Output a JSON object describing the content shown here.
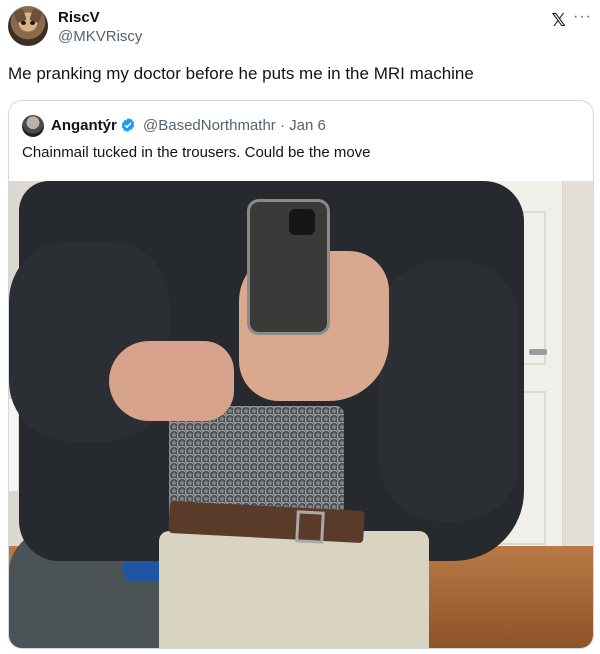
{
  "post": {
    "display_name": "RiscV",
    "handle": "@MKVRiscy",
    "text": "Me pranking my doctor before he puts me in the MRI machine",
    "x_logo": "𝕏",
    "more_label": "···"
  },
  "quote": {
    "display_name": "Angantýr",
    "verified": true,
    "handle_date": "@BasedNorthmathr · Jan 6",
    "text": "Chainmail tucked in the trousers. Could be the move"
  },
  "colors": {
    "text_primary": "#0f1419",
    "text_secondary": "#536471",
    "verified_blue": "#1d9bf0",
    "border": "#cfd9de"
  },
  "icons": {
    "verified": "verified-badge-icon",
    "more": "more-options-icon",
    "logo": "x-logo-icon"
  }
}
